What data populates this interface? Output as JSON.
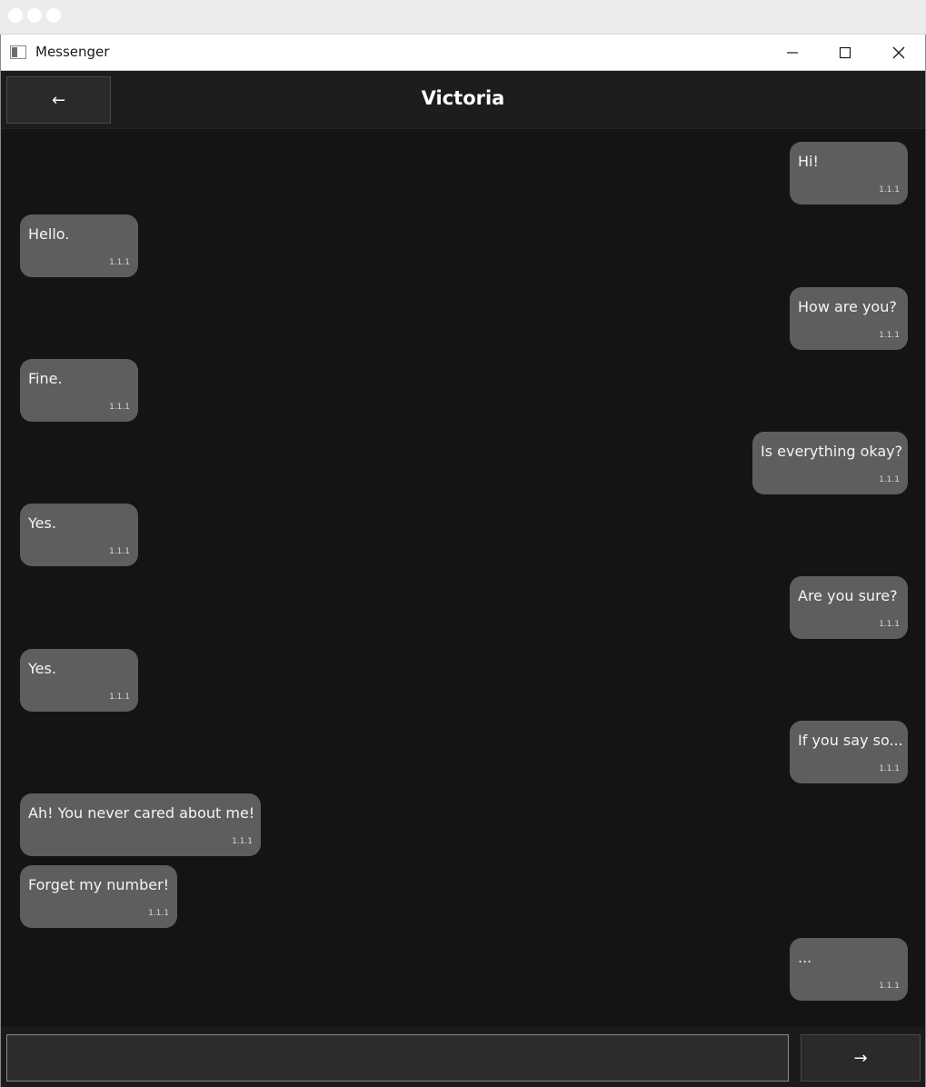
{
  "window": {
    "title": "Messenger"
  },
  "header": {
    "back_label": "←",
    "contact_name": "Victoria"
  },
  "messages": [
    {
      "text": "Hi!",
      "time": "1.1.1",
      "side": "right"
    },
    {
      "text": "Hello.",
      "time": "1.1.1",
      "side": "left"
    },
    {
      "text": "How are you?",
      "time": "1.1.1",
      "side": "right"
    },
    {
      "text": "Fine.",
      "time": "1.1.1",
      "side": "left"
    },
    {
      "text": "Is everything okay?",
      "time": "1.1.1",
      "side": "right"
    },
    {
      "text": "Yes.",
      "time": "1.1.1",
      "side": "left"
    },
    {
      "text": "Are you sure?",
      "time": "1.1.1",
      "side": "right"
    },
    {
      "text": "Yes.",
      "time": "1.1.1",
      "side": "left"
    },
    {
      "text": "If you say so...",
      "time": "1.1.1",
      "side": "right"
    },
    {
      "text": "Ah! You never cared about me!",
      "time": "1.1.1",
      "side": "left"
    },
    {
      "text": "Forget my number!",
      "time": "1.1.1",
      "side": "left"
    },
    {
      "text": "...",
      "time": "1.1.1",
      "side": "right"
    }
  ],
  "composer": {
    "value": "",
    "send_label": "→"
  },
  "colors": {
    "background": "#141414",
    "bubble": "#5e5e5e",
    "header": "#1d1d1d"
  }
}
